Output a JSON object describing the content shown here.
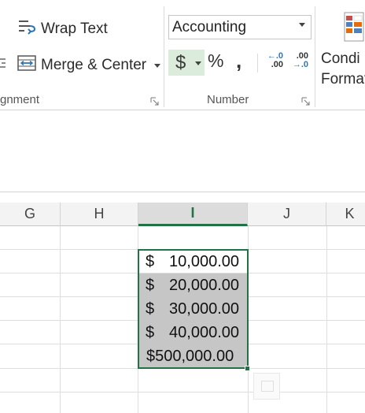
{
  "ribbon": {
    "alignment": {
      "wrap_text_label": "Wrap Text",
      "merge_center_label": "Merge & Center",
      "group_label": "gnment"
    },
    "number": {
      "format_value": "Accounting",
      "currency_symbol": "$",
      "percent_symbol": "%",
      "comma_symbol": ",",
      "increase_decimal_top": "←.0",
      "increase_decimal_bottom": ".00",
      "decrease_decimal_top": ".00",
      "decrease_decimal_bottom": "→.0",
      "group_label": "Number"
    },
    "styles": {
      "conditional_line1": "Condi",
      "conditional_line2": "Format"
    }
  },
  "grid": {
    "columns": [
      "G",
      "H",
      "I",
      "J",
      "K"
    ],
    "active_column": "I",
    "cells_I": [
      {
        "currency": "$",
        "amount": "10,000.00",
        "selected": false
      },
      {
        "currency": "$",
        "amount": "20,000.00",
        "selected": true
      },
      {
        "currency": "$",
        "amount": "30,000.00",
        "selected": true
      },
      {
        "currency": "$",
        "amount": "40,000.00",
        "selected": true
      },
      {
        "full": "$500,000.00",
        "selected": true
      }
    ]
  },
  "colors": {
    "accent": "#217346",
    "selection_fill": "#c6c6c6",
    "active_button": "#dcecdc"
  }
}
